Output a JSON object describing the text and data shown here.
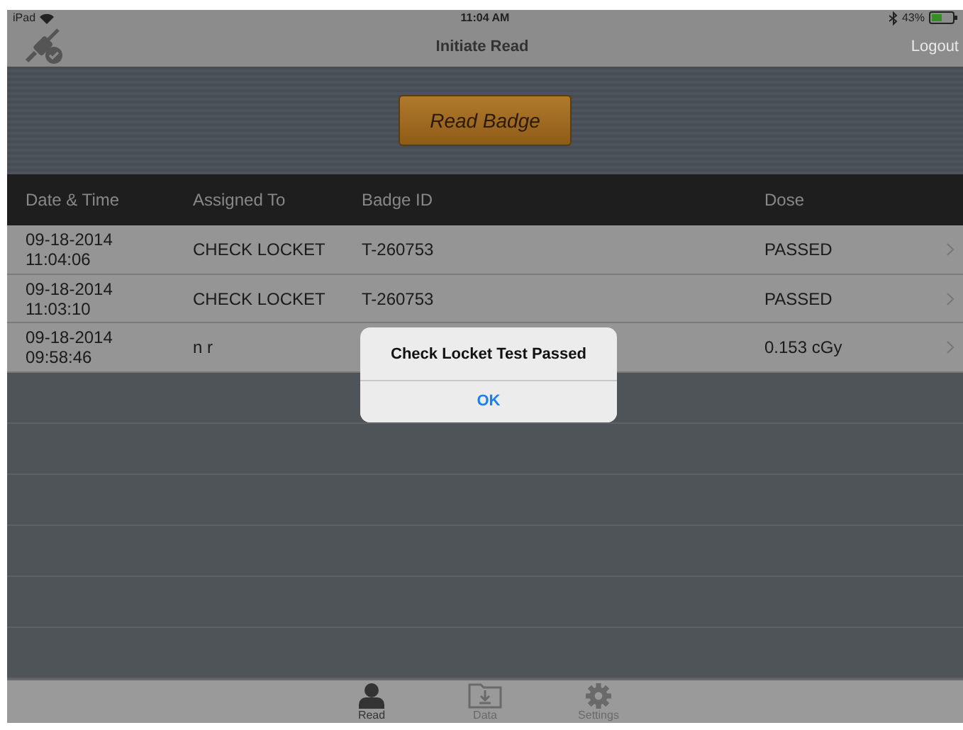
{
  "status_bar": {
    "device": "iPad",
    "time": "11:04 AM",
    "battery": "43%"
  },
  "nav_bar": {
    "title": "Initiate Read",
    "right_button": "Logout"
  },
  "read_button": "Read Badge",
  "table": {
    "columns": [
      "Date & Time",
      "Assigned To",
      "Badge ID",
      "Dose"
    ],
    "rows": [
      {
        "date": "09-18-2014",
        "time": "11:04:06",
        "assigned_to": "CHECK LOCKET",
        "badge_id": "T-260753",
        "dose": "PASSED"
      },
      {
        "date": "09-18-2014",
        "time": "11:03:10",
        "assigned_to": "CHECK LOCKET",
        "badge_id": "T-260753",
        "dose": "PASSED"
      },
      {
        "date": "09-18-2014",
        "time": "09:58:46",
        "assigned_to": "n r",
        "badge_id": "",
        "dose": "0.153 cGy"
      }
    ]
  },
  "alert": {
    "message": "Check Locket Test Passed",
    "button": "OK"
  },
  "tab_bar": [
    {
      "label": "Read",
      "kind": "person",
      "selected": true
    },
    {
      "label": "Data",
      "kind": "download",
      "selected": false
    },
    {
      "label": "Settings",
      "kind": "gear",
      "selected": false
    }
  ]
}
